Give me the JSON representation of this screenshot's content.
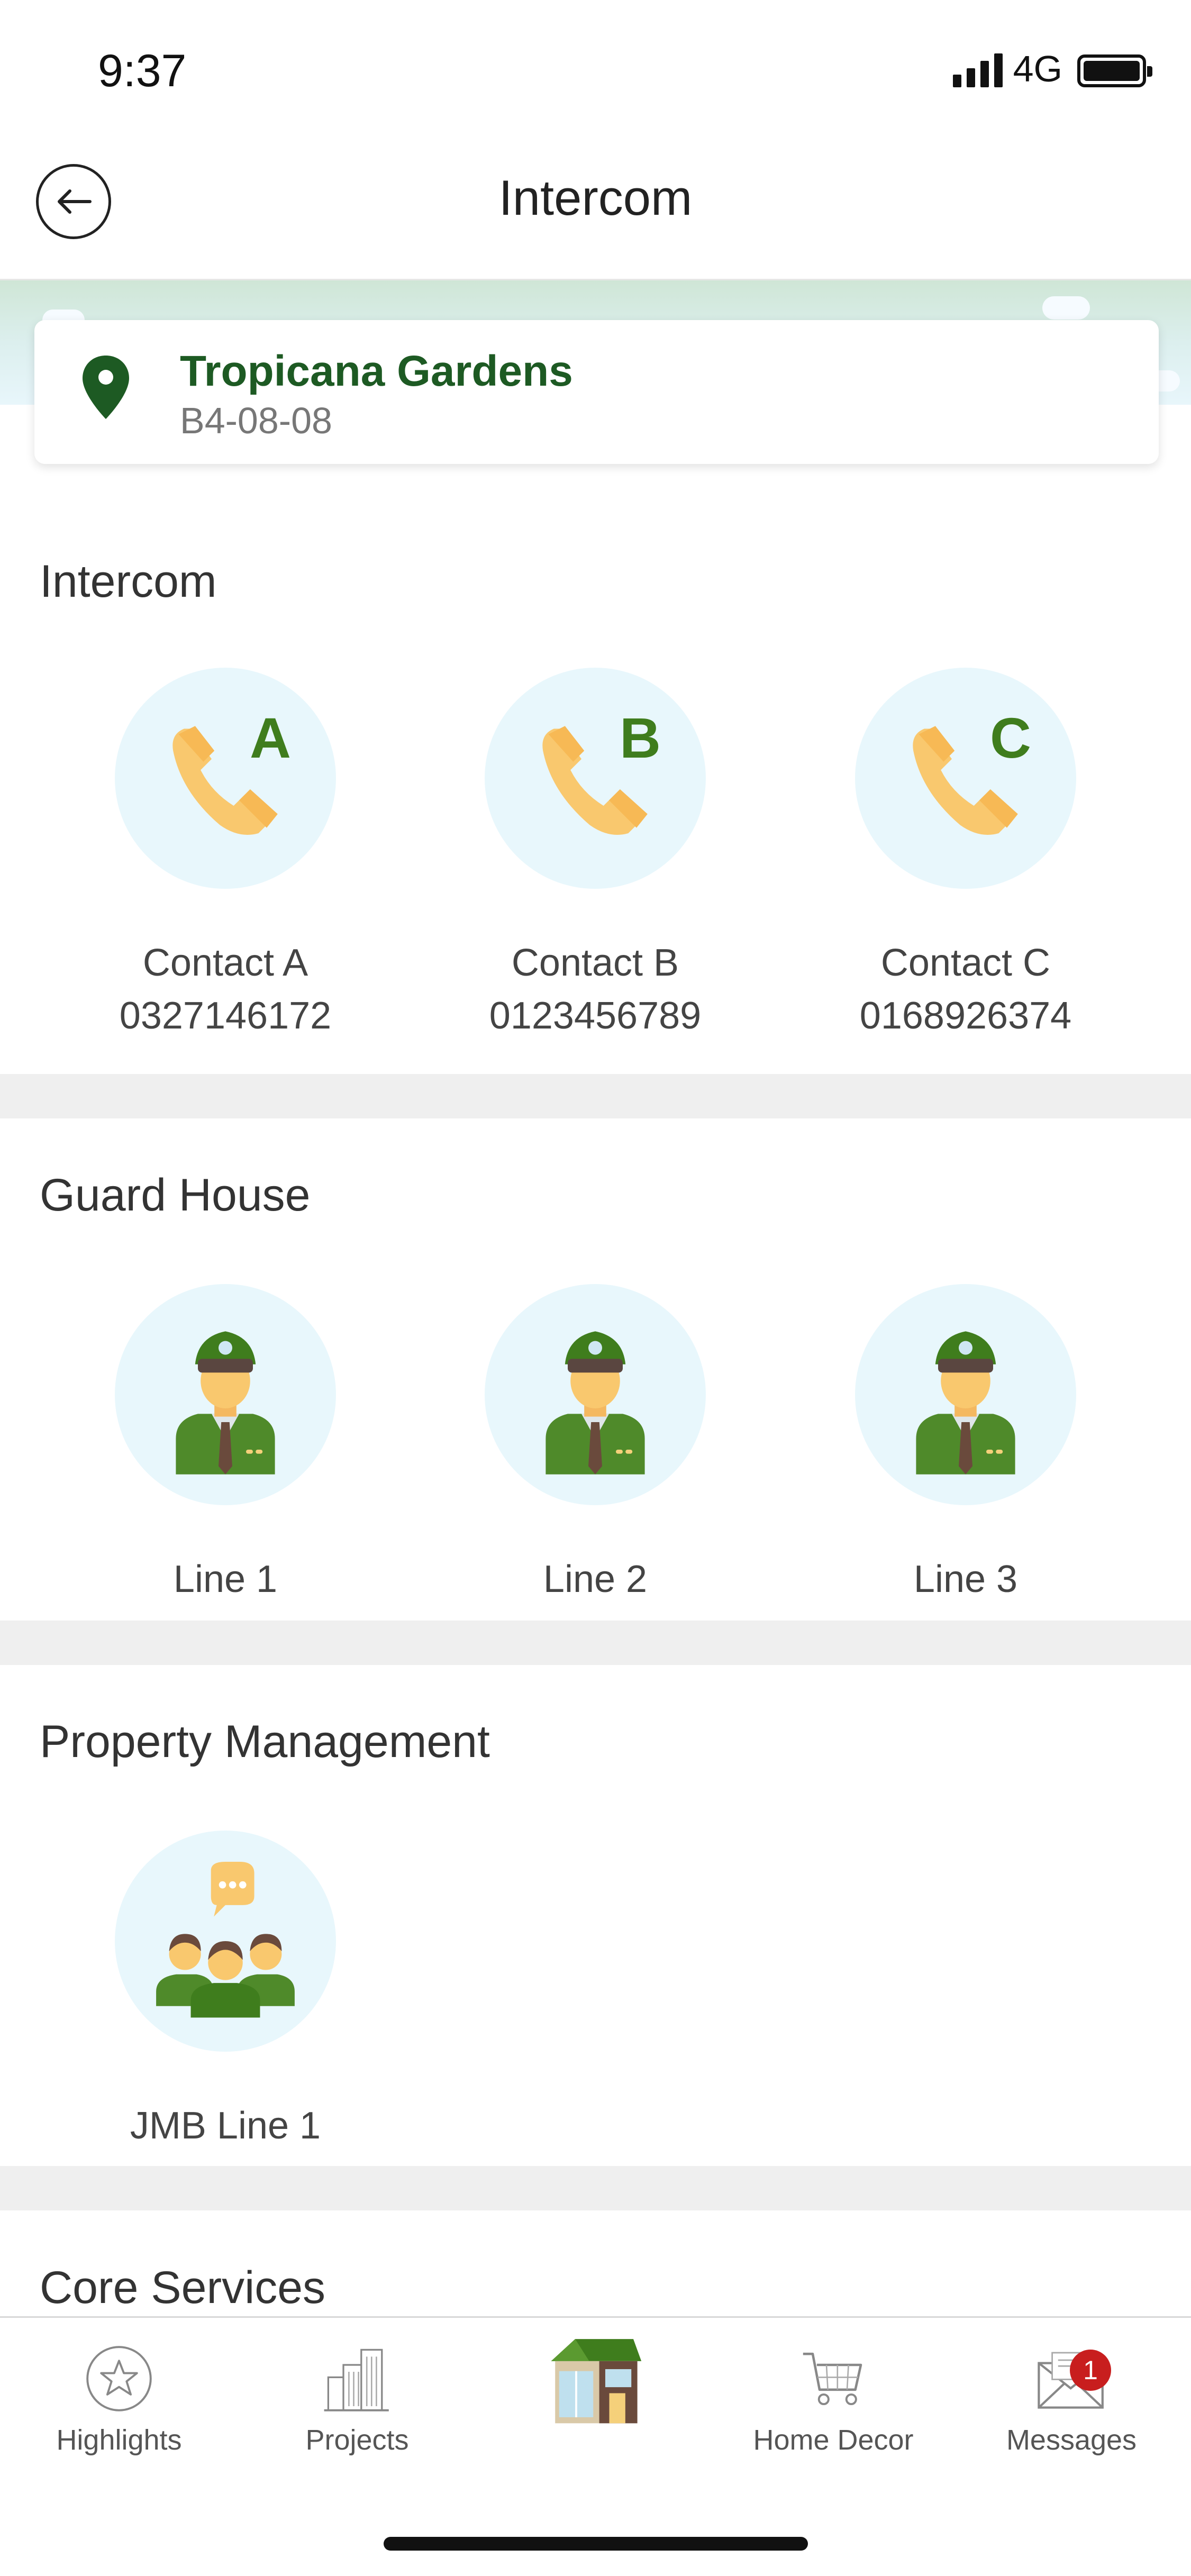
{
  "status_bar": {
    "time": "9:37",
    "network": "4G"
  },
  "header": {
    "title": "Intercom"
  },
  "location": {
    "name": "Tropicana Gardens",
    "unit": "B4-08-08"
  },
  "intercom": {
    "title": "Intercom",
    "contacts": [
      {
        "letter": "A",
        "name": "Contact A",
        "number": "0327146172"
      },
      {
        "letter": "B",
        "name": "Contact B",
        "number": "0123456789"
      },
      {
        "letter": "C",
        "name": "Contact C",
        "number": "0168926374"
      }
    ]
  },
  "guard_house": {
    "title": "Guard House",
    "lines": [
      {
        "label": "Line 1"
      },
      {
        "label": "Line 2"
      },
      {
        "label": "Line 3"
      }
    ]
  },
  "property_management": {
    "title": "Property Management",
    "lines": [
      {
        "label": "JMB Line 1"
      }
    ]
  },
  "core_services": {
    "title": "Core Services"
  },
  "bottom_nav": {
    "items": [
      {
        "label": "Highlights",
        "icon": "star-icon"
      },
      {
        "label": "Projects",
        "icon": "buildings-icon"
      },
      {
        "label": "",
        "icon": "house-icon"
      },
      {
        "label": "Home Decor",
        "icon": "cart-icon"
      },
      {
        "label": "Messages",
        "icon": "envelope-icon",
        "badge": "1"
      }
    ]
  },
  "colors": {
    "accent": "#1d5a23",
    "circle_bg": "#e8f7fc",
    "badge": "#c81e1e",
    "divider": "#efefef"
  }
}
